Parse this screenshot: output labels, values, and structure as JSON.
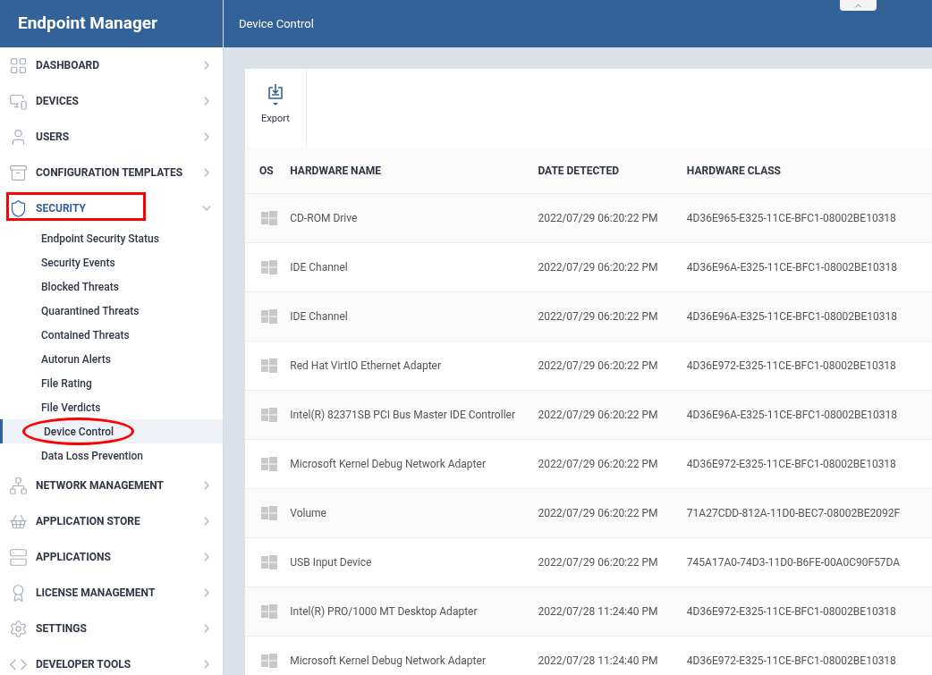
{
  "app_title": "Endpoint Manager",
  "page_title": "Device Control",
  "sidebar": {
    "items": [
      {
        "label": "DASHBOARD",
        "expanded": false,
        "selected": false
      },
      {
        "label": "DEVICES",
        "expanded": false,
        "selected": false
      },
      {
        "label": "USERS",
        "expanded": false,
        "selected": false
      },
      {
        "label": "CONFIGURATION TEMPLATES",
        "expanded": false,
        "selected": false
      },
      {
        "label": "SECURITY",
        "expanded": true,
        "selected": true,
        "children": [
          {
            "label": "Endpoint Security Status",
            "selected": false
          },
          {
            "label": "Security Events",
            "selected": false
          },
          {
            "label": "Blocked Threats",
            "selected": false
          },
          {
            "label": "Quarantined Threats",
            "selected": false
          },
          {
            "label": "Contained Threats",
            "selected": false
          },
          {
            "label": "Autorun Alerts",
            "selected": false
          },
          {
            "label": "File Rating",
            "selected": false
          },
          {
            "label": "File Verdicts",
            "selected": false
          },
          {
            "label": "Device Control",
            "selected": true
          },
          {
            "label": "Data Loss Prevention",
            "selected": false
          }
        ]
      },
      {
        "label": "NETWORK MANAGEMENT",
        "expanded": false,
        "selected": false
      },
      {
        "label": "APPLICATION STORE",
        "expanded": false,
        "selected": false
      },
      {
        "label": "APPLICATIONS",
        "expanded": false,
        "selected": false
      },
      {
        "label": "LICENSE MANAGEMENT",
        "expanded": false,
        "selected": false
      },
      {
        "label": "SETTINGS",
        "expanded": false,
        "selected": false
      },
      {
        "label": "DEVELOPER TOOLS",
        "expanded": false,
        "selected": false
      }
    ]
  },
  "toolbar": {
    "export_label": "Export"
  },
  "table": {
    "columns": [
      "OS",
      "HARDWARE NAME",
      "DATE DETECTED",
      "HARDWARE CLASS"
    ],
    "rows": [
      [
        "",
        "CD-ROM Drive",
        "2022/07/29 06:20:22 PM",
        "4D36E965-E325-11CE-BFC1-08002BE10318"
      ],
      [
        "",
        "IDE Channel",
        "2022/07/29 06:20:22 PM",
        "4D36E96A-E325-11CE-BFC1-08002BE10318"
      ],
      [
        "",
        "IDE Channel",
        "2022/07/29 06:20:22 PM",
        "4D36E96A-E325-11CE-BFC1-08002BE10318"
      ],
      [
        "",
        "Red Hat VirtIO Ethernet Adapter",
        "2022/07/29 06:20:22 PM",
        "4D36E972-E325-11CE-BFC1-08002BE10318"
      ],
      [
        "",
        "Intel(R) 82371SB PCI Bus Master IDE Controller",
        "2022/07/29 06:20:22 PM",
        "4D36E96A-E325-11CE-BFC1-08002BE10318"
      ],
      [
        "",
        "Microsoft Kernel Debug Network Adapter",
        "2022/07/29 06:20:22 PM",
        "4D36E972-E325-11CE-BFC1-08002BE10318"
      ],
      [
        "",
        "Volume",
        "2022/07/29 06:20:22 PM",
        "71A27CDD-812A-11D0-BEC7-08002BE2092F"
      ],
      [
        "",
        "USB Input Device",
        "2022/07/29 06:20:22 PM",
        "745A17A0-74D3-11D0-B6FE-00A0C90F57DA"
      ],
      [
        "",
        "Intel(R) PRO/1000 MT Desktop Adapter",
        "2022/07/28 11:24:40 PM",
        "4D36E972-E325-11CE-BFC1-08002BE10318"
      ],
      [
        "",
        "Microsoft Kernel Debug Network Adapter",
        "2022/07/28 11:24:40 PM",
        "4D36E972-E325-11CE-BFC1-08002BE10318"
      ]
    ]
  }
}
